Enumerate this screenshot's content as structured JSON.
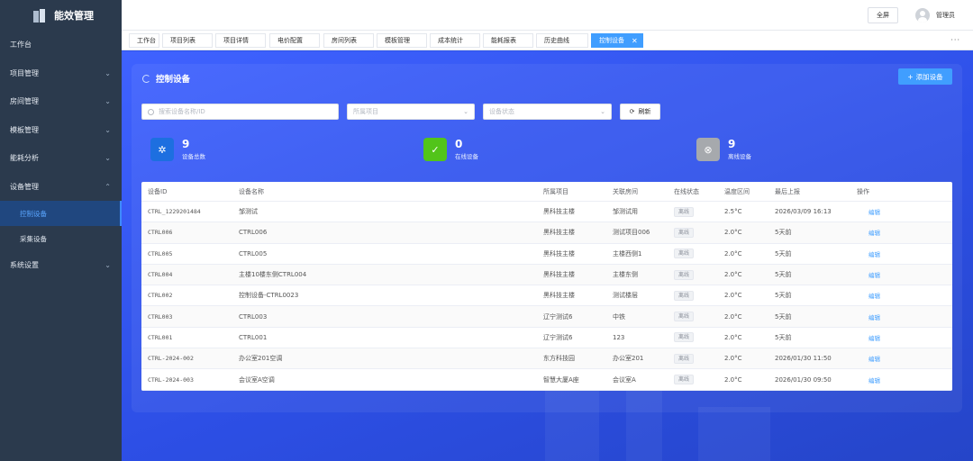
{
  "app": {
    "title": "能效管理"
  },
  "sidebar": {
    "items": [
      {
        "label": "工作台",
        "has_children": false
      },
      {
        "label": "项目管理",
        "has_children": true,
        "chevron": "⌄"
      },
      {
        "label": "房间管理",
        "has_children": true,
        "chevron": "⌄"
      },
      {
        "label": "模板管理",
        "has_children": true,
        "chevron": "⌄"
      },
      {
        "label": "能耗分析",
        "has_children": true,
        "chevron": "⌄"
      },
      {
        "label": "设备管理",
        "has_children": true,
        "chevron": "⌃",
        "expanded": true
      }
    ],
    "sub_items": [
      {
        "label": "控制设备",
        "active": true
      },
      {
        "label": "采集设备",
        "active": false
      }
    ],
    "last_item": {
      "label": "系统设置",
      "chevron": "⌄"
    }
  },
  "header": {
    "fullscreen_label": "全屏",
    "user_name": "管理员"
  },
  "tabs": [
    {
      "label": "工作台"
    },
    {
      "label": "项目列表"
    },
    {
      "label": "项目详情"
    },
    {
      "label": "电价配置"
    },
    {
      "label": "房间列表"
    },
    {
      "label": "模板管理"
    },
    {
      "label": "成本统计"
    },
    {
      "label": "能耗报表"
    },
    {
      "label": "历史曲线"
    },
    {
      "label": "控制设备",
      "active": true,
      "close": "✕"
    }
  ],
  "tab_more": "···",
  "page": {
    "title": "控制设备",
    "add_button": "添加设备",
    "add_icon": "+"
  },
  "filters": {
    "search_placeholder": "搜索设备名称/ID",
    "project_placeholder": "所属项目",
    "status_placeholder": "设备状态",
    "refresh_label": "刷新",
    "refresh_icon": "⟳",
    "caret": "⌄"
  },
  "stats": [
    {
      "value": "9",
      "label": "设备总数",
      "color": "#1d6fe0",
      "icon": "✲"
    },
    {
      "value": "0",
      "label": "在线设备",
      "color": "#52c41a",
      "icon": "✓"
    },
    {
      "value": "9",
      "label": "离线设备",
      "color": "#a6a9ad",
      "icon": "⊗"
    }
  ],
  "table": {
    "headers": [
      "设备ID",
      "设备名称",
      "所属项目",
      "关联房间",
      "在线状态",
      "温度区间",
      "最后上报",
      "操作"
    ],
    "rows": [
      [
        "CTRL_1229201484",
        "邹测试",
        "黑科技主楼",
        "邹测试用",
        "离线",
        "2.5°C",
        "2026/03/09 16:13",
        "编辑"
      ],
      [
        "CTRL006",
        "CTRL006",
        "黑科技主楼",
        "测试项目006",
        "离线",
        "2.0°C",
        "5天前",
        "编辑"
      ],
      [
        "CTRL005",
        "CTRL005",
        "黑科技主楼",
        "主楼西侧1",
        "离线",
        "2.0°C",
        "5天前",
        "编辑"
      ],
      [
        "CTRL004",
        "主楼10楼东侧CTRL004",
        "黑科技主楼",
        "主楼东侧",
        "离线",
        "2.0°C",
        "5天前",
        "编辑"
      ],
      [
        "CTRL002",
        "控制设备-CTRL0023",
        "黑科技主楼",
        "测试楼层",
        "离线",
        "2.0°C",
        "5天前",
        "编辑"
      ],
      [
        "CTRL003",
        "CTRL003",
        "辽宁测试6",
        "中铁",
        "离线",
        "2.0°C",
        "5天前",
        "编辑"
      ],
      [
        "CTRL001",
        "CTRL001",
        "辽宁测试6",
        "123",
        "离线",
        "2.0°C",
        "5天前",
        "编辑"
      ],
      [
        "CTRL-2024-002",
        "办公室201空调",
        "东方科技园",
        "办公室201",
        "离线",
        "2.0°C",
        "2026/01/30 11:50",
        "编辑"
      ],
      [
        "CTRL-2024-003",
        "会议室A空调",
        "智慧大厦A座",
        "会议室A",
        "离线",
        "2.0°C",
        "2026/01/30 09:50",
        "编辑"
      ]
    ]
  }
}
